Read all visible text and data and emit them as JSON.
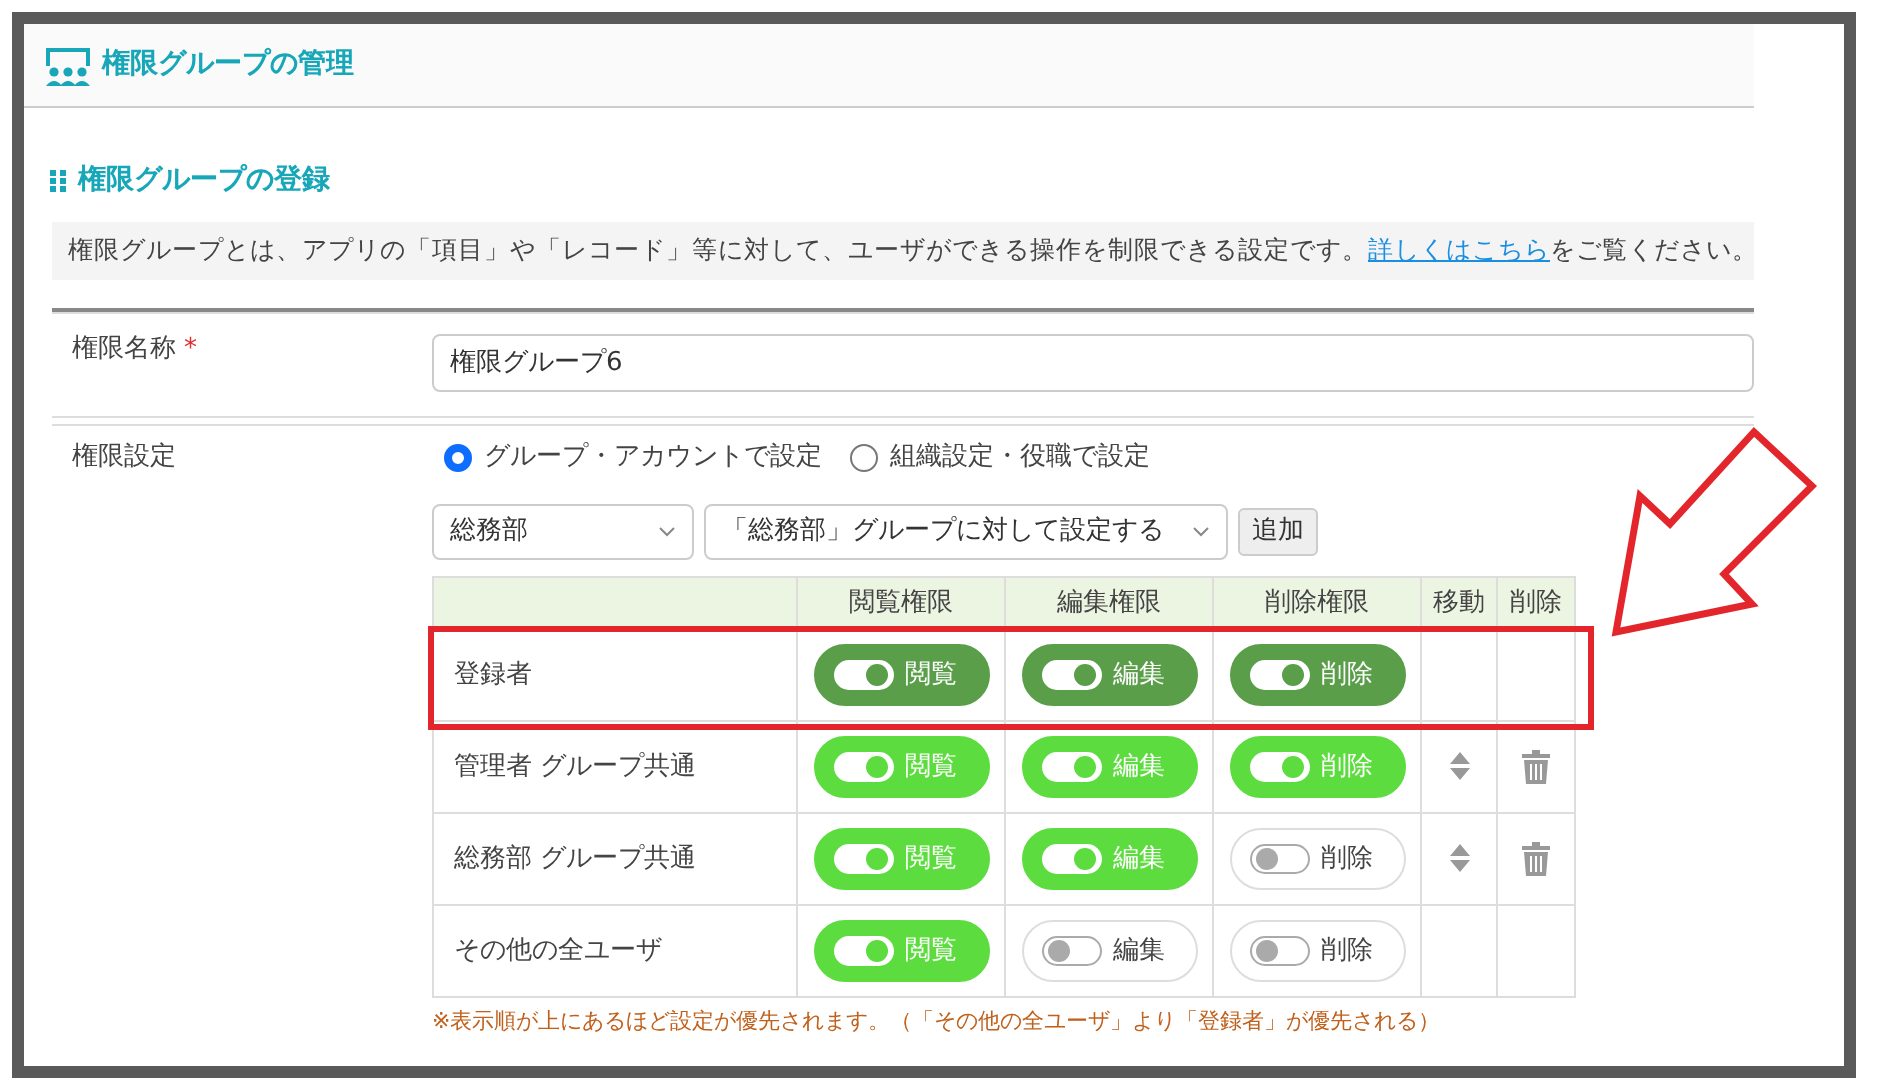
{
  "header": {
    "title": "権限グループの管理"
  },
  "section": {
    "title": "権限グループの登録",
    "description": "権限グループとは、アプリの「項目」や「レコード」等に対して、ユーザができる操作を制限できる設定です。",
    "link": "詳しくはこちら",
    "description_end": "をご覧ください。"
  },
  "name_field": {
    "label": "権限名称",
    "required_mark": "*",
    "value": "権限グループ6"
  },
  "setting": {
    "label": "権限設定",
    "radios": [
      {
        "label": "グループ・アカウントで設定",
        "selected": true
      },
      {
        "label": "組織設定・役職で設定",
        "selected": false
      }
    ],
    "group_select": "総務部",
    "target_select": "「総務部」グループに対して設定する",
    "add_button": "追加"
  },
  "table": {
    "columns": [
      "",
      "閲覧権限",
      "編集権限",
      "削除権限",
      "移動",
      "削除"
    ],
    "rows": [
      {
        "name": "登録者",
        "locked": true,
        "highlighted": true,
        "movable": false,
        "deletable": false,
        "toggles": [
          {
            "label": "閲覧",
            "on": true
          },
          {
            "label": "編集",
            "on": true
          },
          {
            "label": "削除",
            "on": true
          }
        ]
      },
      {
        "name": "管理者 グループ共通",
        "locked": false,
        "highlighted": false,
        "movable": true,
        "deletable": true,
        "toggles": [
          {
            "label": "閲覧",
            "on": true
          },
          {
            "label": "編集",
            "on": true
          },
          {
            "label": "削除",
            "on": true
          }
        ]
      },
      {
        "name": "総務部 グループ共通",
        "locked": false,
        "highlighted": false,
        "movable": true,
        "deletable": true,
        "toggles": [
          {
            "label": "閲覧",
            "on": true
          },
          {
            "label": "編集",
            "on": true
          },
          {
            "label": "削除",
            "on": false
          }
        ]
      },
      {
        "name": "その他の全ユーザ",
        "locked": false,
        "highlighted": false,
        "movable": false,
        "deletable": false,
        "toggles": [
          {
            "label": "閲覧",
            "on": true
          },
          {
            "label": "編集",
            "on": false
          },
          {
            "label": "削除",
            "on": false
          }
        ]
      }
    ]
  },
  "note": "※表示順が上にあるほど設定が優先されます。（「その他の全ユーザ」より「登録者」が優先される）"
}
